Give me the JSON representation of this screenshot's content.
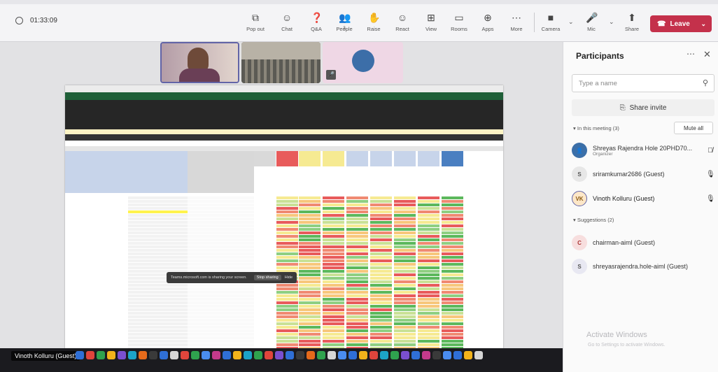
{
  "meeting": {
    "timer": "01:33:09"
  },
  "toolbar": {
    "items": [
      {
        "label": "Pop out",
        "icon": "pop-out-icon"
      },
      {
        "label": "Chat",
        "icon": "chat-icon"
      },
      {
        "label": "Q&A",
        "icon": "qa-icon"
      },
      {
        "label": "People",
        "icon": "people-icon",
        "count": "3"
      },
      {
        "label": "Raise",
        "icon": "raise-hand-icon"
      },
      {
        "label": "React",
        "icon": "react-icon"
      },
      {
        "label": "View",
        "icon": "view-icon"
      },
      {
        "label": "Rooms",
        "icon": "rooms-icon"
      },
      {
        "label": "Apps",
        "icon": "apps-icon"
      },
      {
        "label": "More",
        "icon": "more-icon"
      }
    ],
    "camera_label": "Camera",
    "mic_label": "Mic",
    "share_label": "Share",
    "leave_label": "Leave",
    "leave_color": "#c4314b"
  },
  "stage": {
    "speaker_name": "Vinoth Kolluru (Guest)",
    "toast_text": "Teams.microsoft.com is sharing your screen.",
    "toast_stop": "Stop sharing",
    "toast_hide": "Hide"
  },
  "panel": {
    "title": "Participants",
    "search_placeholder": "Type a name",
    "share_invite": "Share invite",
    "in_meeting_label": "In this meeting (3)",
    "mute_all": "Mute all",
    "suggestions_label": "Suggestions (2)",
    "participants": [
      {
        "name": "Shreyas Rajendra Hole 20PHD70...",
        "role": "Organizer",
        "initials": "",
        "mic": "muted"
      },
      {
        "name": "sriramkumar2686 (Guest)",
        "role": "",
        "initials": "S",
        "mic": "on"
      },
      {
        "name": "Vinoth Kolluru (Guest)",
        "role": "",
        "initials": "VK",
        "mic": "on"
      }
    ],
    "suggestions": [
      {
        "name": "chairman-aiml (Guest)",
        "initials": "C"
      },
      {
        "name": "shreyasrajendra.hole-aiml (Guest)",
        "initials": "S"
      }
    ]
  },
  "watermark": {
    "title": "Activate Windows",
    "subtitle": "Go to Settings to activate Windows."
  }
}
